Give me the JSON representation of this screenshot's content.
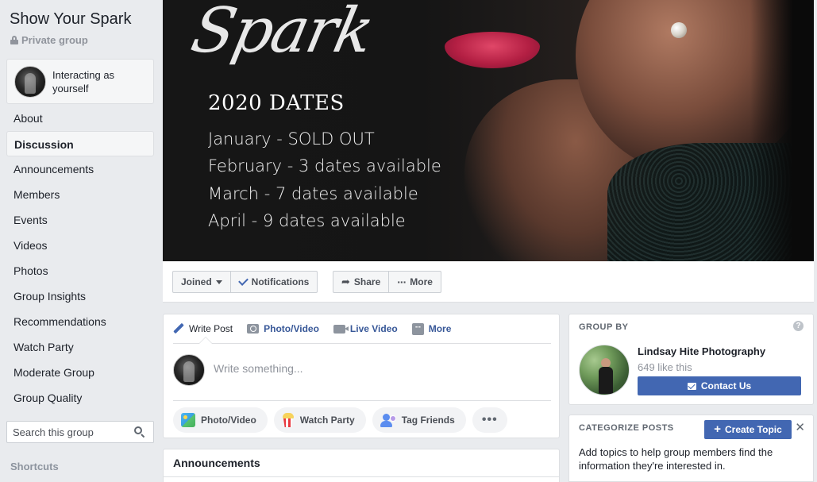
{
  "sidebar": {
    "group_title": "Show Your Spark",
    "privacy": "Private group",
    "interacting": "Interacting as yourself",
    "nav": [
      {
        "label": "About"
      },
      {
        "label": "Discussion",
        "active": true
      },
      {
        "label": "Announcements"
      },
      {
        "label": "Members"
      },
      {
        "label": "Events"
      },
      {
        "label": "Videos"
      },
      {
        "label": "Photos"
      },
      {
        "label": "Group Insights"
      },
      {
        "label": "Recommendations"
      },
      {
        "label": "Watch Party"
      },
      {
        "label": "Moderate Group"
      },
      {
        "label": "Group Quality"
      }
    ],
    "search_placeholder": "Search this group",
    "shortcuts_label": "Shortcuts"
  },
  "cover": {
    "script_title": "Spark",
    "dates_title": "2020 DATES",
    "lines": [
      "January - SOLD OUT",
      "February - 3 dates available",
      "March - 7 dates available",
      "April - 9 dates available"
    ]
  },
  "actions": {
    "joined": "Joined",
    "notifications": "Notifications",
    "share": "Share",
    "more": "More"
  },
  "composer": {
    "tabs": {
      "write_post": "Write Post",
      "photo_video": "Photo/Video",
      "live_video": "Live Video",
      "more": "More"
    },
    "placeholder": "Write something...",
    "pills": {
      "photo_video": "Photo/Video",
      "watch_party": "Watch Party",
      "tag_friends": "Tag Friends"
    }
  },
  "announcements": {
    "title": "Announcements"
  },
  "group_by": {
    "label": "GROUP BY",
    "page_name": "Lindsay Hite Photography",
    "likes": "649 like this",
    "contact": "Contact Us"
  },
  "categorize": {
    "label": "CATEGORIZE POSTS",
    "create_topic": "Create Topic",
    "description": "Add topics to help group members find the information they're interested in."
  },
  "colors": {
    "accent": "#4267b2",
    "background": "#e9ebee",
    "link": "#385898"
  }
}
